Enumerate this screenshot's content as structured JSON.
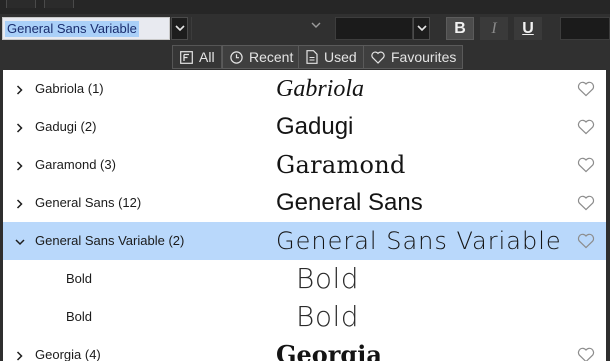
{
  "toolbar": {
    "font_family_value": "General Sans Variable",
    "bold_label": "B",
    "italic_label": "I",
    "underline_label": "U"
  },
  "filters": [
    {
      "label": "All",
      "icon": "font-box-icon",
      "active": true
    },
    {
      "label": "Recent",
      "icon": "clock-icon",
      "active": false
    },
    {
      "label": "Used",
      "icon": "document-icon",
      "active": false
    },
    {
      "label": "Favourites",
      "icon": "heart-icon",
      "active": false
    }
  ],
  "font_list": {
    "rows": [
      {
        "name": "Gabriola (1)",
        "preview": "Gabriola",
        "expander": "collapsed",
        "selected": false
      },
      {
        "name": "Gadugi (2)",
        "preview": "Gadugi",
        "expander": "collapsed",
        "selected": false
      },
      {
        "name": "Garamond (3)",
        "preview": "Garamond",
        "expander": "collapsed",
        "selected": false
      },
      {
        "name": "General Sans (12)",
        "preview": "General Sans",
        "expander": "collapsed",
        "selected": false
      },
      {
        "name": "General Sans Variable (2)",
        "preview": "General Sans Variable",
        "expander": "expanded",
        "selected": true
      },
      {
        "name": "Bold",
        "preview": "Bold",
        "child": true
      },
      {
        "name": "Bold",
        "preview": "Bold",
        "child": true
      },
      {
        "name": "Georgia (4)",
        "preview": "Georgia",
        "expander": "collapsed",
        "selected": false
      }
    ]
  },
  "colors": {
    "selected_row": "#b9d8fb",
    "input_highlight": "#aad0f8",
    "toolbar_bg": "#303030"
  }
}
